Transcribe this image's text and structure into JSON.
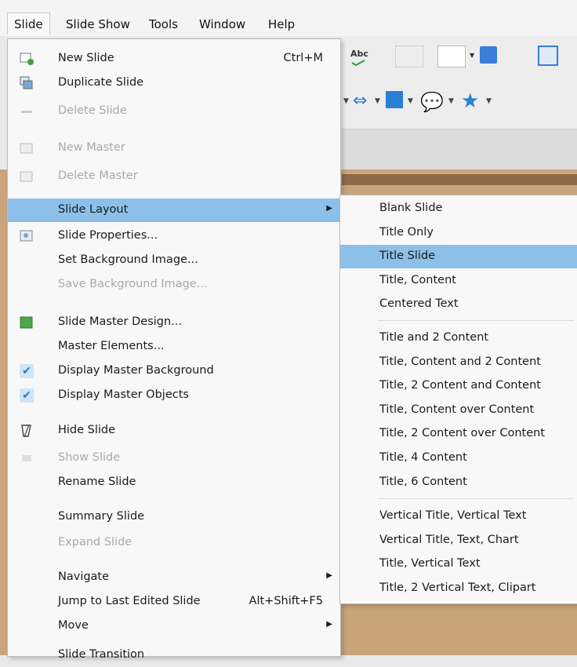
{
  "menubar": {
    "items": [
      {
        "label": "Slide"
      },
      {
        "label": "Slide Show"
      },
      {
        "label": "Tools"
      },
      {
        "label": "Window"
      },
      {
        "label": "Help"
      }
    ]
  },
  "toolbar": {
    "spelling_label": "Abc"
  },
  "slide_menu": {
    "items": [
      {
        "label": "New Slide",
        "shortcut": "Ctrl+M",
        "enabled": true,
        "icon": "new-slide-icon"
      },
      {
        "label": "Duplicate Slide",
        "enabled": true,
        "icon": "duplicate-slide-icon"
      },
      {
        "label": "Delete Slide",
        "enabled": false,
        "icon": "delete-slide-icon"
      },
      {
        "label": "New Master",
        "enabled": false,
        "icon": "new-master-icon"
      },
      {
        "label": "Delete Master",
        "enabled": false,
        "icon": "delete-master-icon"
      },
      {
        "label": "Slide Layout",
        "enabled": true,
        "submenu": true,
        "highlighted": true
      },
      {
        "label": "Slide Properties...",
        "enabled": true,
        "icon": "slide-properties-icon"
      },
      {
        "label": "Set Background Image...",
        "enabled": true
      },
      {
        "label": "Save Background Image...",
        "enabled": false
      },
      {
        "label": "Slide Master Design...",
        "enabled": true,
        "icon": "master-design-icon"
      },
      {
        "label": "Master Elements...",
        "enabled": true
      },
      {
        "label": "Display Master Background",
        "enabled": true,
        "checked": true
      },
      {
        "label": "Display Master Objects",
        "enabled": true,
        "checked": true
      },
      {
        "label": "Hide Slide",
        "enabled": true,
        "icon": "hide-slide-icon"
      },
      {
        "label": "Show Slide",
        "enabled": false,
        "icon": "show-slide-icon"
      },
      {
        "label": "Rename Slide",
        "enabled": true
      },
      {
        "label": "Summary Slide",
        "enabled": true
      },
      {
        "label": "Expand Slide",
        "enabled": false
      },
      {
        "label": "Navigate",
        "enabled": true,
        "submenu": true
      },
      {
        "label": "Jump to Last Edited Slide",
        "shortcut": "Alt+Shift+F5",
        "enabled": true
      },
      {
        "label": "Move",
        "enabled": true,
        "submenu": true
      },
      {
        "label": "Slide Transition",
        "enabled": true
      }
    ]
  },
  "layout_submenu": {
    "items": [
      {
        "label": "Blank Slide"
      },
      {
        "label": "Title Only"
      },
      {
        "label": "Title Slide",
        "highlighted": true
      },
      {
        "label": "Title, Content"
      },
      {
        "label": "Centered Text"
      },
      {
        "label": "Title and 2 Content"
      },
      {
        "label": "Title, Content and 2 Content"
      },
      {
        "label": "Title, 2 Content and Content"
      },
      {
        "label": "Title, Content over Content"
      },
      {
        "label": "Title, 2 Content over Content"
      },
      {
        "label": "Title, 4 Content"
      },
      {
        "label": "Title, 6 Content"
      },
      {
        "label": "Vertical Title, Vertical Text"
      },
      {
        "label": "Vertical Title, Text, Chart"
      },
      {
        "label": "Title, Vertical Text"
      },
      {
        "label": "Title, 2 Vertical Text, Clipart"
      }
    ]
  },
  "colors": {
    "highlight": "#8cc0e8",
    "check": "#2a78c8",
    "menu_bg": "#f8f8f8"
  }
}
